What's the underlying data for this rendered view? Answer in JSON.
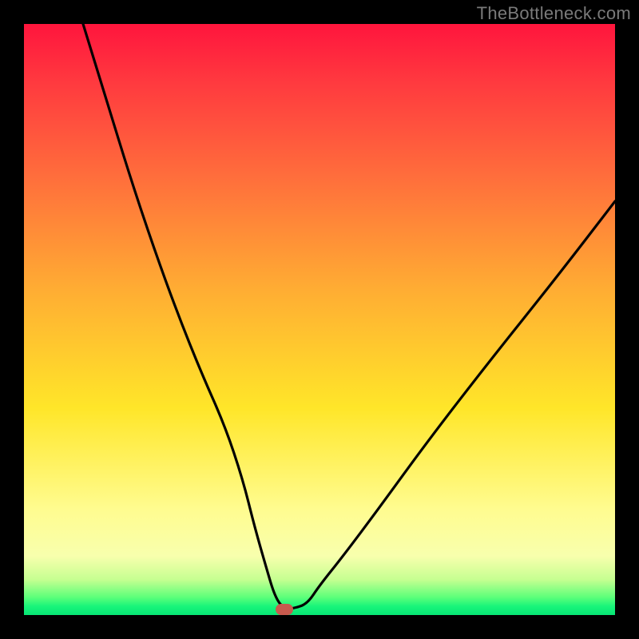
{
  "watermark": "TheBottleneck.com",
  "colors": {
    "frame": "#000000",
    "curve": "#000000",
    "marker": "#c85a4e",
    "gradient_stops": [
      "#ff153d",
      "#ff6b3c",
      "#ffe629",
      "#fffc8f",
      "#19f57a"
    ]
  },
  "chart_data": {
    "type": "line",
    "title": "",
    "xlabel": "",
    "ylabel": "",
    "xlim": [
      0,
      100
    ],
    "ylim": [
      0,
      100
    ],
    "grid": false,
    "legend_position": "none",
    "series": [
      {
        "name": "bottleneck-curve",
        "x": [
          10,
          14,
          18,
          22,
          26,
          30,
          34,
          37,
          39,
          41,
          42.5,
          44,
          46,
          48,
          50,
          54,
          60,
          68,
          78,
          90,
          100
        ],
        "values": [
          100,
          87,
          74,
          62,
          51,
          41,
          32,
          23,
          15,
          8,
          3,
          1,
          1.2,
          2,
          5,
          10,
          18,
          29,
          42,
          57,
          70
        ]
      }
    ],
    "marker": {
      "x": 44,
      "y": 1,
      "shape": "rounded-rect",
      "color": "#c85a4e"
    },
    "note": "Values estimated from pixel positions; axes have no labeled ticks."
  }
}
